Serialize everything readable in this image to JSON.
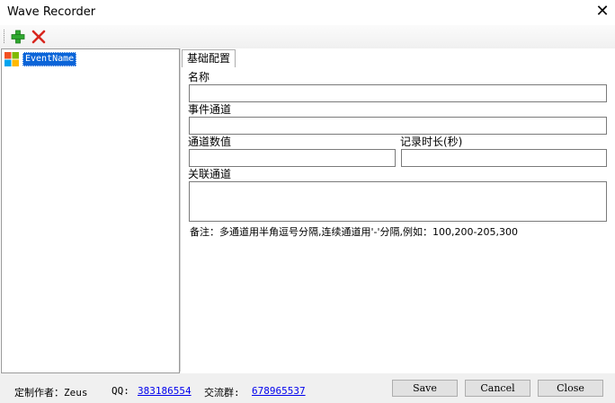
{
  "window": {
    "title": "Wave Recorder",
    "close_glyph": "✕"
  },
  "toolbar": {
    "add_icon": "plus-icon",
    "delete_icon": "delete-x-icon"
  },
  "tree": {
    "items": [
      {
        "label": "EventName",
        "icon": "windows-logo-icon"
      }
    ]
  },
  "tabs": [
    {
      "label": "基础配置"
    }
  ],
  "form": {
    "name_label": "名称",
    "name_value": "",
    "event_channel_label": "事件通道",
    "event_channel_value": "",
    "channel_value_label": "通道数值",
    "channel_value_value": "",
    "duration_label": "记录时长(秒)",
    "duration_value": "",
    "related_channel_label": "关联通道",
    "related_channel_value": "",
    "note": "备注：多通道用半角逗号分隔,连续通道用'-'分隔,例如：100,200-205,300"
  },
  "status": {
    "author_label": "定制作者：Zeus",
    "qq_label": "QQ:",
    "qq_value": "383186554",
    "group_label": "交流群:",
    "group_value": "678965537"
  },
  "buttons": {
    "save": "Save",
    "cancel": "Cancel",
    "close": "Close"
  }
}
